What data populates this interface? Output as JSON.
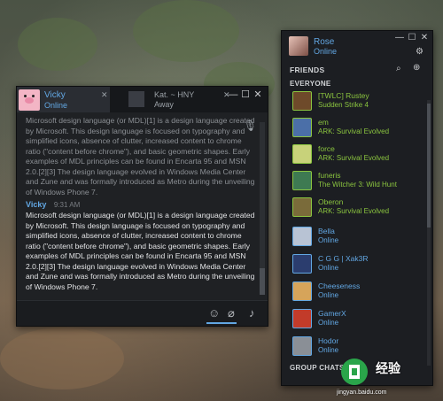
{
  "chat": {
    "active_tab": {
      "name": "Vicky",
      "status": "Online"
    },
    "inactive_tab": {
      "name": "Kat. ~ HNY",
      "status": "Away"
    },
    "messages": {
      "previous_text": "Microsoft design language (or MDL)[1] is a design language created by Microsoft. This design language is focused on typography and simplified icons, absence of clutter, increased content to chrome ratio (\"content before chrome\"), and basic geometric shapes. Early examples of MDL principles can be found in Encarta 95 and MSN 2.0.[2][3] The design language evolved in Windows Media Center and Zune and was formally introduced as Metro during the unveiling of Windows Phone 7.",
      "sender": "Vicky",
      "time": "9:31 AM",
      "text": "Microsoft design language (or MDL)[1] is a design language created by Microsoft. This design language is focused on typography and simplified icons, absence of clutter, increased content to chrome ratio (\"content before chrome\"), and basic geometric shapes. Early examples of MDL principles can be found in Encarta 95 and MSN 2.0.[2][3] The design language evolved in Windows Media Center and Zune and was formally introduced as Metro during the unveiling of Windows Phone 7."
    },
    "icons": {
      "emoji": "emoji-icon",
      "attach": "paperclip-icon",
      "voice": "microphone-icon"
    }
  },
  "friends_panel": {
    "me": {
      "name": "Rose",
      "status": "Online"
    },
    "title": "FRIENDS",
    "group_header": "EVERYONE",
    "group_chats": "GROUP CHATS",
    "friends": [
      {
        "name": "[TWLC] Rustey",
        "status": "Sudden Strike 4",
        "state": "ingame",
        "color": "#6e4a2a"
      },
      {
        "name": "em",
        "status": "ARK: Survival Evolved",
        "state": "ingame",
        "color": "#4b6fa8"
      },
      {
        "name": "force",
        "status": "ARK: Survival Evolved",
        "state": "ingame",
        "color": "#c8d27a"
      },
      {
        "name": "funeris",
        "status": "The Witcher 3: Wild Hunt",
        "state": "ingame",
        "color": "#3e7a52"
      },
      {
        "name": "Oberon",
        "status": "ARK: Survival Evolved",
        "state": "ingame",
        "color": "#7a6b3a"
      },
      {
        "name": "Bella",
        "status": "Online",
        "state": "online",
        "color": "#b8c3d4"
      },
      {
        "name": "C G G | Xak3R",
        "status": "Online",
        "state": "online",
        "color": "#2b3d6e"
      },
      {
        "name": "Cheeseness",
        "status": "Online",
        "state": "online",
        "color": "#d6a45a"
      },
      {
        "name": "GamerX",
        "status": "Online",
        "state": "online",
        "color": "#c23b2a"
      },
      {
        "name": "Hodor",
        "status": "Online",
        "state": "online",
        "color": "#8a8f96"
      }
    ],
    "colors": {
      "ingame": "#8bc53f",
      "online": "#62a7e3"
    }
  },
  "watermark": {
    "text": "经验",
    "url": "jingyan.baidu.com"
  }
}
